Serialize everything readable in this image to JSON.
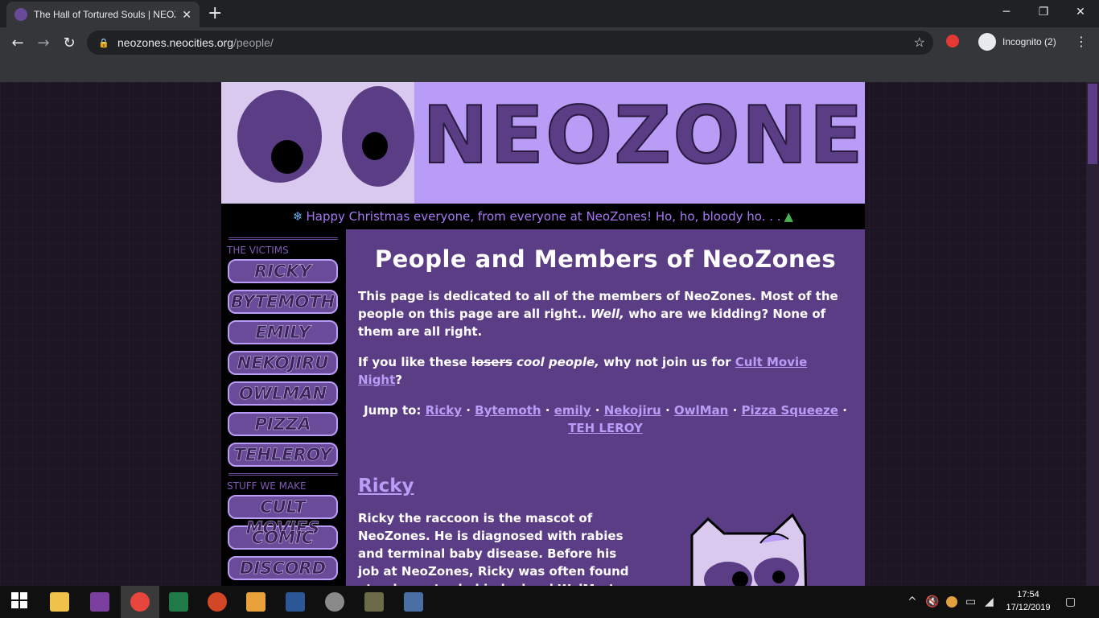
{
  "browser": {
    "tab_title": "The Hall of Tortured Souls | NEOZ",
    "tab_close": "✕",
    "new_tab": "+",
    "url_host": "neozones.neocities.org",
    "url_path": "/people/",
    "incognito_label": "Incognito (2)",
    "window_min": "─",
    "window_max": "❐",
    "window_close": "✕"
  },
  "banner": {
    "logo_text": "NEOZONES"
  },
  "ticker": {
    "text": "Happy Christmas everyone, from everyone at NeoZones! Ho, ho, bloody ho. . ."
  },
  "sidebar": {
    "victims_heading": "THE VICTIMS",
    "victims": [
      "RICKY",
      "BYTEMOTH",
      "EMILY",
      "NEKOJIRU",
      "OWLMAN",
      "PIZZA",
      "TEHLEROY"
    ],
    "stuff_heading": "STUFF WE MAKE",
    "stuff": [
      "CULT MOVIES",
      "COMIC",
      "DISCORD"
    ]
  },
  "content": {
    "title": "People and Members of NeoZones",
    "intro_a": "This page is dedicated to all of the members of NeoZones. Most of the people on this page are all right.. ",
    "intro_em": "Well,",
    "intro_b": " who are we kidding? None of them are all right.",
    "join_a": "If you like these ",
    "join_strike": "losers",
    "join_em": " cool people,",
    "join_b": " why not join us for ",
    "join_link": "Cult Movie Night",
    "join_end": "?",
    "jump_label": "Jump to:",
    "jump_links": [
      "Ricky",
      "Bytemoth",
      "emily",
      "Nekojiru",
      "OwlMan",
      "Pizza Squeeze",
      "TEH LEROY"
    ],
    "jump_sep": "·",
    "section_title": "Ricky",
    "section_bio": "Ricky the raccoon is the mascot of NeoZones. He is diagnosed with rabies and terminal baby disease. Before his job at NeoZones, Ricky was often found at a dumpster behind a local WalMart"
  },
  "taskbar": {
    "time": "17:54",
    "date": "17/12/2019"
  },
  "colors": {
    "page_bg": "#1d1424",
    "content_bg": "#5b3d86",
    "accent": "#b99cf5",
    "link": "#b99cf5"
  }
}
